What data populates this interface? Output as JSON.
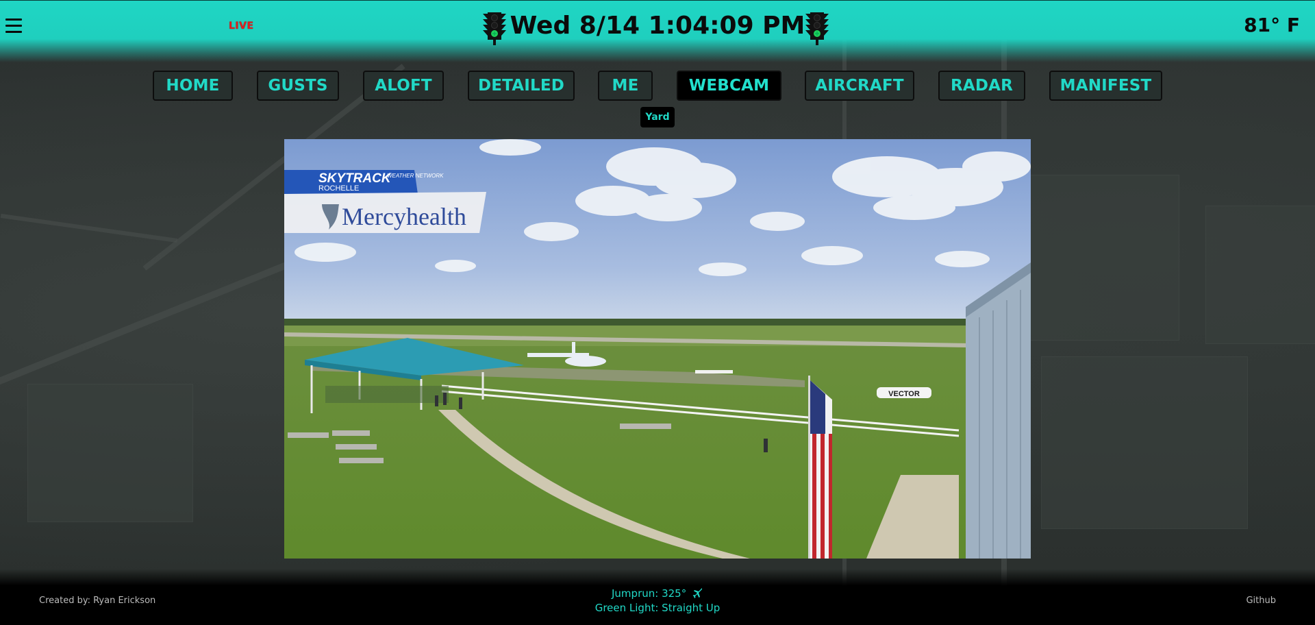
{
  "header": {
    "live_label": "LIVE",
    "datetime": "Wed 8/14 1:04:09 PM",
    "temperature": "81° F",
    "left_icon": "traffic-light-icon",
    "right_icon": "traffic-light-icon",
    "menu_icon": "hamburger-menu-icon"
  },
  "nav": {
    "items": [
      {
        "label": "HOME"
      },
      {
        "label": "GUSTS"
      },
      {
        "label": "ALOFT"
      },
      {
        "label": "DETAILED"
      },
      {
        "label": "ME"
      },
      {
        "label": "WEBCAM",
        "active": true
      },
      {
        "label": "AIRCRAFT"
      },
      {
        "label": "RADAR"
      },
      {
        "label": "MANIFEST"
      }
    ],
    "tooltip": "Yard"
  },
  "webcam": {
    "overlay_brand": "SKYTRACK",
    "overlay_brand_sub": "WEATHER NETWORK",
    "overlay_location": "ROCHELLE",
    "overlay_sponsor": "Mercyhealth",
    "trailer_text": "VECTOR"
  },
  "footer": {
    "credit": "Created by: Ryan Erickson",
    "jumprun": "Jumprun: 325°",
    "jumprun_icon": "airplane-icon",
    "green_light": "Green Light: Straight Up",
    "github": "Github"
  },
  "colors": {
    "accent": "#21d9c7",
    "header_bg": "#1fd6c4",
    "live": "#e01f1f",
    "nav_active_bg": "#000000"
  }
}
